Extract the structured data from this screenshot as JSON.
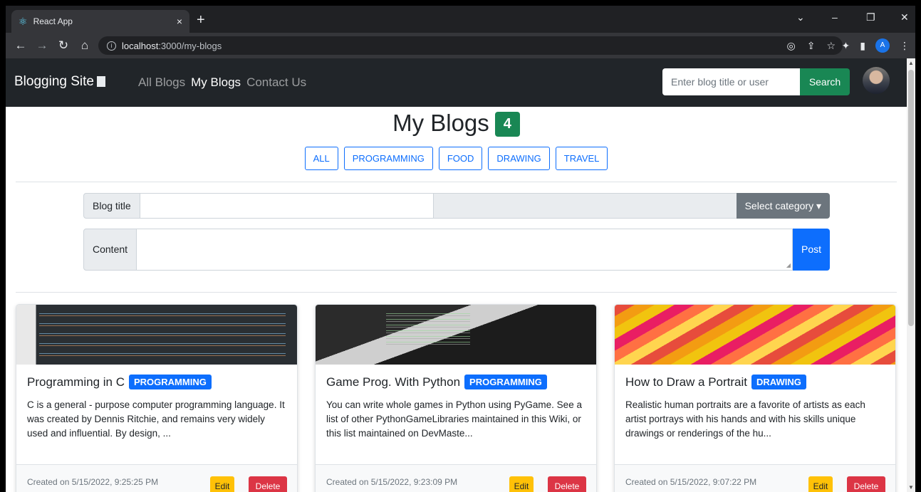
{
  "browser": {
    "tab_title": "React App",
    "tab_close": "×",
    "new_tab": "+",
    "url_host": "localhost",
    "url_path": ":3000/my-blogs",
    "profile_initial": "A"
  },
  "navbar": {
    "brand": "Blogging Site",
    "links": [
      "All Blogs",
      "My Blogs",
      "Contact Us"
    ],
    "active_link": "My Blogs",
    "search_placeholder": "Enter blog title or user",
    "search_label": "Search"
  },
  "page": {
    "title": "My Blogs",
    "count": "4",
    "filters": [
      "ALL",
      "PROGRAMMING",
      "FOOD",
      "DRAWING",
      "TRAVEL"
    ]
  },
  "form": {
    "title_label": "Blog title",
    "title_value": "",
    "category_label": "Select category",
    "content_label": "Content",
    "content_value": "",
    "post_label": "Post"
  },
  "cards": [
    {
      "title": "Programming in C",
      "category": "PROGRAMMING",
      "text": "C is a general - purpose computer programming language. It was created by Dennis Ritchie, and remains very widely used and influential. By design, ...",
      "created": "Created on 5/15/2022, 9:25:25 PM",
      "edit": "Edit",
      "delete": "Delete"
    },
    {
      "title": "Game Prog. With Python",
      "category": "PROGRAMMING",
      "text": "You can write whole games in Python using PyGame. See a list of other PythonGameLibraries maintained in this Wiki, or this list maintained on DevMaste...",
      "created": "Created on 5/15/2022, 9:23:09 PM",
      "edit": "Edit",
      "delete": "Delete"
    },
    {
      "title": "How to Draw a Portrait",
      "category": "DRAWING",
      "text": "Realistic human portraits are a favorite of artists as each artist portrays with his hands and with his skills unique drawings or renderings of the hu...",
      "created": "Created on 5/15/2022, 9:07:22 PM",
      "edit": "Edit",
      "delete": "Delete"
    }
  ],
  "colors": {
    "navbar_bg": "#212529",
    "success": "#198754",
    "primary": "#0d6efd",
    "warning": "#ffc107",
    "danger": "#dc3545",
    "secondary": "#6c757d"
  }
}
